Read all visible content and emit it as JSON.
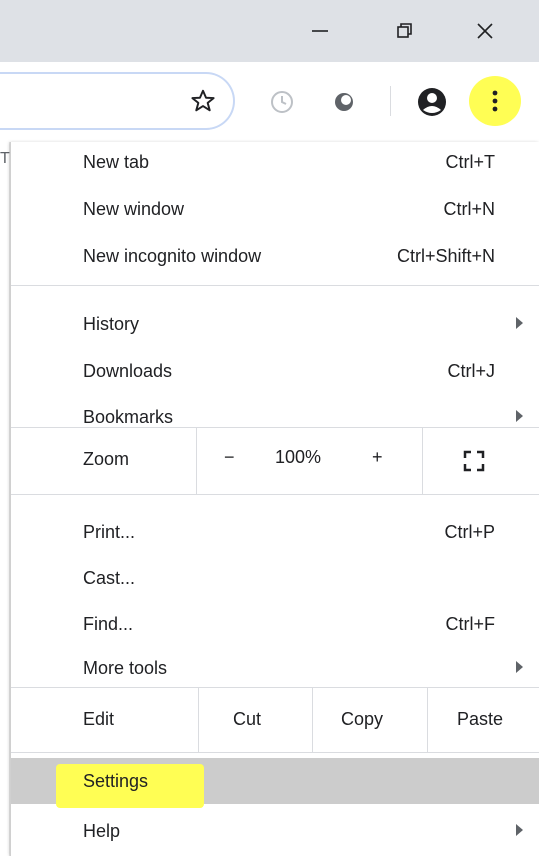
{
  "window_controls": {
    "minimize": "minimize",
    "maximize": "restore",
    "close": "close"
  },
  "toolbar": {
    "icons": [
      "star-icon",
      "history-icon",
      "extension-icon",
      "profile-icon",
      "kebab-menu-icon"
    ],
    "highlight_color": "#fffe54"
  },
  "page": {
    "partial_letter": "T"
  },
  "menu": {
    "group1": [
      {
        "label": "New tab",
        "shortcut": "Ctrl+T"
      },
      {
        "label": "New window",
        "shortcut": "Ctrl+N"
      },
      {
        "label": "New incognito window",
        "shortcut": "Ctrl+Shift+N"
      }
    ],
    "group2": [
      {
        "label": "History",
        "shortcut": ""
      },
      {
        "label": "Downloads",
        "shortcut": "Ctrl+J"
      },
      {
        "label": "Bookmarks",
        "shortcut": ""
      }
    ],
    "zoom": {
      "label": "Zoom",
      "minus": "−",
      "value": "100%",
      "plus": "+"
    },
    "group3": [
      {
        "label": "Print...",
        "shortcut": "Ctrl+P"
      },
      {
        "label": "Cast...",
        "shortcut": ""
      },
      {
        "label": "Find...",
        "shortcut": "Ctrl+F"
      },
      {
        "label": "More tools",
        "shortcut": ""
      }
    ],
    "edit": {
      "label": "Edit",
      "cut": "Cut",
      "copy": "Copy",
      "paste": "Paste"
    },
    "group4": [
      {
        "label": "Settings",
        "shortcut": ""
      },
      {
        "label": "Help",
        "shortcut": ""
      }
    ],
    "hover_color": "#cccccc"
  }
}
